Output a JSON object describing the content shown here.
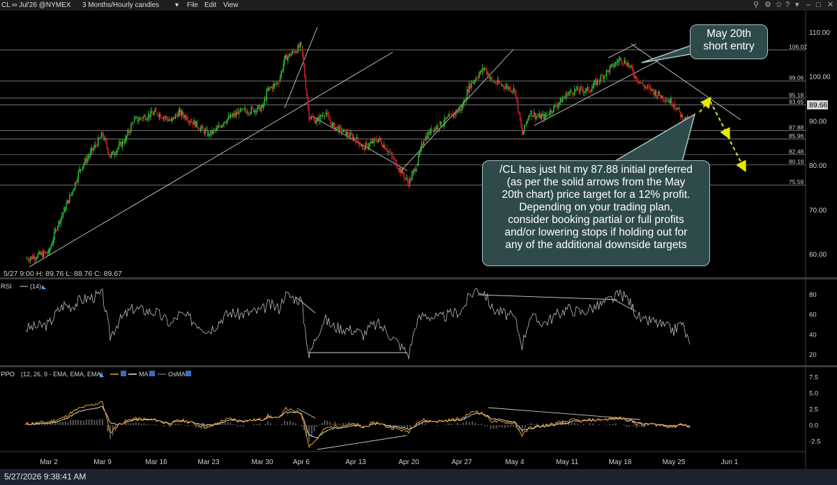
{
  "header": {
    "symbol": "CL ∞ Jul'26 @NYMEX",
    "period": "3 Months/Hourly candles",
    "menus": [
      "File",
      "Edit",
      "View"
    ]
  },
  "ohlc": "5/27 9:00   H: 89.76   L: 88.76   C: 89.67",
  "last_price": "89.66",
  "footer_timestamp": "5/27/2026 9:38:41 AM",
  "callouts": {
    "entry": [
      "May 20th",
      "short entry"
    ],
    "target": [
      "/CL has just hit my 87.88 initial preferred",
      "(as per the solid arrows from the May",
      "20th chart) price target for a 12% profit.",
      "Depending on your trading plan,",
      "consider booking partial or full profits",
      "and/or lowering stops if holding out for",
      "any of the additional downside targets"
    ]
  },
  "rsi_legend": {
    "name": "RSI",
    "param": "(14)"
  },
  "ppo_legend": {
    "name": "PPO",
    "params": "(12, 26, 9 - EMA, EMA, EMA)",
    "ma": "MA",
    "osma": "OsMA"
  },
  "colors": {
    "up": "#2ecc40",
    "down": "#e0202a",
    "price_line": "#ffffff",
    "arrow": "#e8e800",
    "ppo": "#f0a020",
    "signal": "#e6e6e6",
    "hist": "#555555"
  },
  "chart_data": [
    {
      "type": "line",
      "panel": "price",
      "title": "CL ∞ Jul'26 @NYMEX",
      "ylim": [
        55,
        111
      ],
      "y_ticks": [
        "110.00",
        "100.00",
        "90.00",
        "80.00",
        "70.00",
        "60.00"
      ],
      "x_ticks": [
        "Mar 2",
        "Mar 9",
        "Mar 16",
        "Mar 23",
        "Mar 30",
        "Apr 6",
        "Apr 13",
        "Apr 20",
        "Apr 27",
        "May 4",
        "May 11",
        "May 18",
        "May 25",
        "Jun 1"
      ],
      "levels": [
        "106.02",
        "99.06",
        "95.18",
        "93.65",
        "87.88",
        "85.96",
        "82.48",
        "80.19",
        "75.59"
      ],
      "series": [
        {
          "x": [
            "Feb 27",
            "Mar 2",
            "Mar 3",
            "Mar 4",
            "Mar 5",
            "Mar 6",
            "Mar 9",
            "Mar 10",
            "Mar 11",
            "Mar 12",
            "Mar 13",
            "Mar 16",
            "Mar 17",
            "Mar 18",
            "Mar 19",
            "Mar 20",
            "Mar 23",
            "Mar 24",
            "Mar 25",
            "Mar 26",
            "Mar 27",
            "Mar 30",
            "Mar 31",
            "Apr 1",
            "Apr 2",
            "Apr 3",
            "Apr 6",
            "Apr 7",
            "Apr 8",
            "Apr 9",
            "Apr 10",
            "Apr 13",
            "Apr 14",
            "Apr 15",
            "Apr 16",
            "Apr 17",
            "Apr 20",
            "Apr 21",
            "Apr 22",
            "Apr 23",
            "Apr 24",
            "Apr 27",
            "Apr 28",
            "Apr 29",
            "Apr 30",
            "May 1",
            "May 4",
            "May 5",
            "May 6",
            "May 7",
            "May 8",
            "May 11",
            "May 12",
            "May 13",
            "May 14",
            "May 15",
            "May 18",
            "May 19",
            "May 20",
            "May 21",
            "May 22",
            "May 25",
            "May 26",
            "May 27"
          ],
          "y": [
            59.0,
            60.5,
            66,
            70,
            74,
            79,
            87,
            82,
            84,
            86,
            90,
            92,
            91,
            90,
            92,
            91,
            87,
            88,
            90,
            91,
            92,
            93,
            97,
            98,
            99,
            104,
            107,
            91,
            90,
            92,
            89,
            86,
            84,
            85,
            86,
            84,
            76,
            80,
            86,
            88,
            89,
            93,
            98,
            100,
            102,
            99,
            97,
            87,
            92,
            91,
            91,
            96,
            97,
            97,
            97,
            99,
            104,
            103,
            100,
            98,
            97,
            94,
            91,
            89.67
          ]
        }
      ]
    },
    {
      "type": "line",
      "panel": "rsi",
      "title": "RSI (14)",
      "ylim": [
        10,
        95
      ],
      "y_ticks": [
        "80",
        "60",
        "40",
        "20"
      ],
      "series": [
        {
          "name": "RSI (14)",
          "x": [
            "Feb 27",
            "Mar 2",
            "Mar 3",
            "Mar 4",
            "Mar 5",
            "Mar 6",
            "Mar 9",
            "Mar 10",
            "Mar 11",
            "Mar 12",
            "Mar 13",
            "Mar 16",
            "Mar 17",
            "Mar 18",
            "Mar 19",
            "Mar 20",
            "Mar 23",
            "Mar 24",
            "Mar 25",
            "Mar 26",
            "Mar 27",
            "Mar 30",
            "Mar 31",
            "Apr 1",
            "Apr 2",
            "Apr 3",
            "Apr 6",
            "Apr 7",
            "Apr 8",
            "Apr 9",
            "Apr 10",
            "Apr 13",
            "Apr 14",
            "Apr 15",
            "Apr 16",
            "Apr 17",
            "Apr 20",
            "Apr 21",
            "Apr 22",
            "Apr 23",
            "Apr 24",
            "Apr 27",
            "Apr 28",
            "Apr 29",
            "Apr 30",
            "May 1",
            "May 4",
            "May 5",
            "May 6",
            "May 7",
            "May 8",
            "May 11",
            "May 12",
            "May 13",
            "May 14",
            "May 15",
            "May 18",
            "May 19",
            "May 20",
            "May 21",
            "May 22",
            "May 25",
            "May 26",
            "May 27"
          ],
          "y": [
            46,
            50,
            62,
            70,
            68,
            74,
            80,
            38,
            52,
            60,
            66,
            62,
            56,
            50,
            60,
            58,
            44,
            50,
            58,
            62,
            60,
            64,
            70,
            68,
            66,
            80,
            74,
            18,
            40,
            56,
            48,
            44,
            40,
            48,
            50,
            44,
            20,
            52,
            60,
            58,
            56,
            64,
            78,
            86,
            82,
            66,
            56,
            30,
            58,
            54,
            52,
            66,
            64,
            62,
            66,
            68,
            80,
            76,
            62,
            52,
            54,
            44,
            52,
            30
          ]
        }
      ]
    },
    {
      "type": "line",
      "panel": "ppo",
      "title": "PPO (12, 26, 9 - EMA, EMA, EMA)",
      "ylim": [
        -4,
        9
      ],
      "y_ticks": [
        "7.5",
        "5.0",
        "2.5",
        "0.0",
        "-2.5"
      ],
      "series": [
        {
          "name": "PPO",
          "x": [
            "Feb 27",
            "Mar 2",
            "Mar 3",
            "Mar 4",
            "Mar 5",
            "Mar 6",
            "Mar 9",
            "Mar 10",
            "Mar 11",
            "Mar 12",
            "Mar 13",
            "Mar 16",
            "Mar 17",
            "Mar 18",
            "Mar 19",
            "Mar 20",
            "Mar 23",
            "Mar 24",
            "Mar 25",
            "Mar 26",
            "Mar 27",
            "Mar 30",
            "Mar 31",
            "Apr 1",
            "Apr 2",
            "Apr 3",
            "Apr 6",
            "Apr 7",
            "Apr 8",
            "Apr 9",
            "Apr 10",
            "Apr 13",
            "Apr 14",
            "Apr 15",
            "Apr 16",
            "Apr 17",
            "Apr 20",
            "Apr 21",
            "Apr 22",
            "Apr 23",
            "Apr 24",
            "Apr 27",
            "Apr 28",
            "Apr 29",
            "Apr 30",
            "May 1",
            "May 4",
            "May 5",
            "May 6",
            "May 7",
            "May 8",
            "May 11",
            "May 12",
            "May 13",
            "May 14",
            "May 15",
            "May 18",
            "May 19",
            "May 20",
            "May 21",
            "May 22",
            "May 25",
            "May 26",
            "May 27"
          ],
          "y": [
            0.2,
            0.5,
            0.8,
            1.2,
            2.0,
            2.6,
            3.6,
            -1.2,
            0.0,
            0.6,
            1.0,
            0.8,
            0.4,
            0.2,
            0.8,
            0.6,
            -0.4,
            0.2,
            0.8,
            1.0,
            0.6,
            0.9,
            1.5,
            1.2,
            1.0,
            2.6,
            1.8,
            -3.2,
            -2.2,
            -0.6,
            -0.2,
            0.1,
            -0.4,
            0.2,
            0.4,
            -0.2,
            -1.0,
            0.4,
            0.8,
            0.6,
            0.6,
            1.0,
            1.8,
            2.2,
            1.6,
            0.6,
            0.3,
            -1.6,
            -0.4,
            -0.2,
            -0.1,
            0.6,
            0.8,
            0.6,
            0.8,
            0.8,
            1.1,
            0.8,
            0.3,
            0.0,
            0.2,
            -0.3,
            0.3,
            -0.4
          ]
        },
        {
          "name": "MA",
          "x": [
            "Feb 27",
            "Mar 2",
            "Mar 3",
            "Mar 4",
            "Mar 5",
            "Mar 6",
            "Mar 9",
            "Mar 10",
            "Mar 11",
            "Mar 12",
            "Mar 13",
            "Mar 16",
            "Mar 17",
            "Mar 18",
            "Mar 19",
            "Mar 20",
            "Mar 23",
            "Mar 24",
            "Mar 25",
            "Mar 26",
            "Mar 27",
            "Mar 30",
            "Mar 31",
            "Apr 1",
            "Apr 2",
            "Apr 3",
            "Apr 6",
            "Apr 7",
            "Apr 8",
            "Apr 9",
            "Apr 10",
            "Apr 13",
            "Apr 14",
            "Apr 15",
            "Apr 16",
            "Apr 17",
            "Apr 20",
            "Apr 21",
            "Apr 22",
            "Apr 23",
            "Apr 24",
            "Apr 27",
            "Apr 28",
            "Apr 29",
            "Apr 30",
            "May 1",
            "May 4",
            "May 5",
            "May 6",
            "May 7",
            "May 8",
            "May 11",
            "May 12",
            "May 13",
            "May 14",
            "May 15",
            "May 18",
            "May 19",
            "May 20",
            "May 21",
            "May 22",
            "May 25",
            "May 26",
            "May 27"
          ],
          "y": [
            0.1,
            0.3,
            0.5,
            0.9,
            1.5,
            2.1,
            2.9,
            0.4,
            0.1,
            0.4,
            0.8,
            0.8,
            0.5,
            0.3,
            0.6,
            0.6,
            0.0,
            0.1,
            0.5,
            0.8,
            0.7,
            0.8,
            1.2,
            1.2,
            1.1,
            2.0,
            1.9,
            -1.5,
            -2.0,
            -1.1,
            -0.5,
            -0.1,
            -0.3,
            0.0,
            0.3,
            0.0,
            -0.6,
            0.0,
            0.5,
            0.6,
            0.6,
            0.8,
            1.4,
            1.9,
            1.7,
            1.0,
            0.5,
            -0.8,
            -0.6,
            -0.3,
            -0.2,
            0.3,
            0.6,
            0.6,
            0.7,
            0.8,
            1.0,
            0.9,
            0.5,
            0.2,
            0.2,
            -0.1,
            0.1,
            -0.2
          ]
        }
      ]
    }
  ]
}
